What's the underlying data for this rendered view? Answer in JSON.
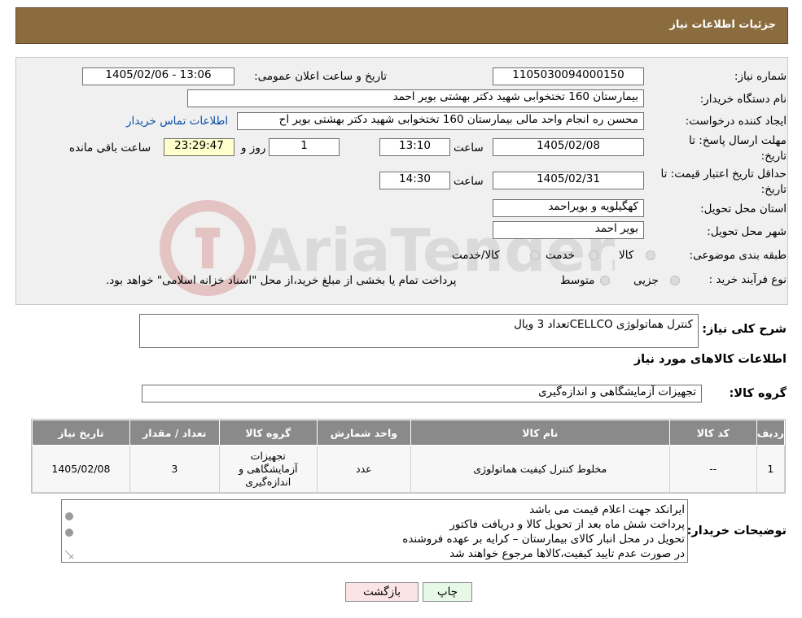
{
  "header": {
    "title": "جزئیات اطلاعات نیاز"
  },
  "form": {
    "need_number_label": "شماره نیاز:",
    "need_number": "1105030094000150",
    "announce_label": "تاریخ و ساعت اعلان عمومی:",
    "announce_value": "1405/02/06 - 13:06",
    "buyer_org_label": "نام دستگاه خریدار:",
    "buyer_org": "بیمارستان 160 تختخوابی شهید دکتر بهشتی بویر احمد",
    "requester_label": "ایجاد کننده درخواست:",
    "requester": "محسن ره انجام واحد مالی بیمارستان 160 تختخوابی شهید دکتر بهشتی بویر اح",
    "contact_link": "اطلاعات تماس خریدار",
    "deadline_label_1": "مهلت ارسال پاسخ: تا",
    "deadline_label_2": "تاریخ:",
    "deadline_date": "1405/02/08",
    "time_label": "ساعت",
    "deadline_time": "13:10",
    "days_value": "1",
    "days_label": "روز و",
    "remaining_time": "23:29:47",
    "remaining_label": "ساعت باقی مانده",
    "validity_label_1": "حداقل تاریخ اعتبار قیمت: تا",
    "validity_label_2": "تاریخ:",
    "validity_date": "1405/02/31",
    "validity_time": "14:30",
    "province_label": "استان محل تحویل:",
    "province": "کهگیلویه و بویراحمد",
    "city_label": "شهر محل تحویل:",
    "city": "بویر احمد",
    "category_label": "طبقه بندی موضوعی:",
    "category_options": [
      "کالا",
      "خدمت",
      "کالا/خدمت"
    ],
    "purchase_type_label": "نوع فرآیند خرید :",
    "purchase_options": [
      "جزیی",
      "متوسط"
    ],
    "purchase_note": "پرداخت تمام یا بخشی از مبلغ خرید،از محل \"اسناد خزانه اسلامی\" خواهد بود."
  },
  "description": {
    "label": "شرح کلی نیاز:",
    "value": "کنترل هماتولوژی  CELLCOتعداد 3 ویال"
  },
  "goods_section_title": "اطلاعات کالاهای مورد نیاز",
  "goods_group": {
    "label": "گروه کالا:",
    "value": "تجهیزات آزمایشگاهی و اندازه‌گیری"
  },
  "table": {
    "headers": [
      "ردیف",
      "کد کالا",
      "نام کالا",
      "واحد شمارش",
      "گروه کالا",
      "تعداد / مقدار",
      "تاریخ نیاز"
    ],
    "rows": [
      {
        "row": "1",
        "code": "--",
        "name": "مخلوط کنترل کیفیت هماتولوژی",
        "unit": "عدد",
        "group": [
          "تجهیزات",
          "آزمایشگاهی و",
          "اندازه‌گیری"
        ],
        "qty": "3",
        "date": "1405/02/08"
      }
    ]
  },
  "buyer_notes": {
    "label": "توضیحات خریدار:",
    "lines": [
      "ایرانکد جهت اعلام قیمت می باشد",
      "پرداخت شش ماه بعد از تحویل کالا و دریافت فاکتور",
      "تحویل در محل انبار کالای بیمارستان – کرایه بر عهده فروشنده",
      "در صورت عدم تایید کیفیت،کالاها مرجوع خواهند شد"
    ]
  },
  "buttons": {
    "back": "بازگشت",
    "print": "چاپ"
  },
  "watermark": {
    "text": "AriaTender.neT"
  },
  "colors": {
    "header_bg": "#8b6c3f",
    "table_header_bg": "#8a8a8a",
    "link": "#0b4fa8"
  }
}
